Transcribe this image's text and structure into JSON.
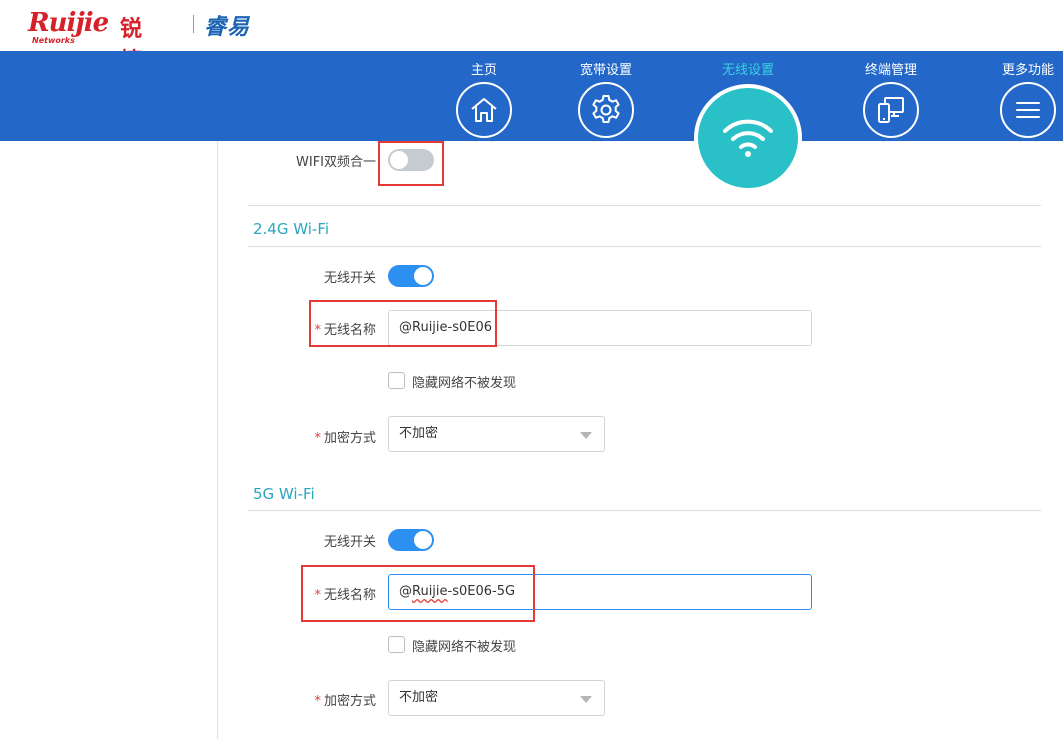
{
  "logo": {
    "brand_word": "Ruijie",
    "brand_cn": "锐捷",
    "brand_sub": "Networks",
    "product": "睿易"
  },
  "nav": {
    "items": [
      {
        "label": "主页",
        "icon": "home-icon"
      },
      {
        "label": "宽带设置",
        "icon": "gear-icon"
      },
      {
        "label": "无线设置",
        "icon": "wifi-icon",
        "active": true
      },
      {
        "label": "终端管理",
        "icon": "devices-icon"
      },
      {
        "label": "更多功能",
        "icon": "menu-icon"
      }
    ],
    "colors": {
      "bar": "#2368c9",
      "active_label": "#3ad2e2",
      "active_circle": "#29c1c7"
    }
  },
  "dual_band": {
    "label": "WIFI双频合一",
    "enabled": false
  },
  "band_24g": {
    "title": "2.4G Wi-Fi",
    "switch_label": "无线开关",
    "switch_on": true,
    "ssid_label": "无线名称",
    "ssid_value": "@Ruijie-s0E06",
    "hide_label": "隐藏网络不被发现",
    "hide_checked": false,
    "encrypt_label": "加密方式",
    "encrypt_value": "不加密"
  },
  "band_5g": {
    "title": "5G Wi-Fi",
    "switch_label": "无线开关",
    "switch_on": true,
    "ssid_label": "无线名称",
    "ssid_prefix": "@",
    "ssid_brand": "Ruijie",
    "ssid_suffix": "-s0E06-5G",
    "hide_label": "隐藏网络不被发现",
    "hide_checked": false,
    "encrypt_label": "加密方式",
    "encrypt_value": "不加密"
  },
  "required_mark": "*"
}
